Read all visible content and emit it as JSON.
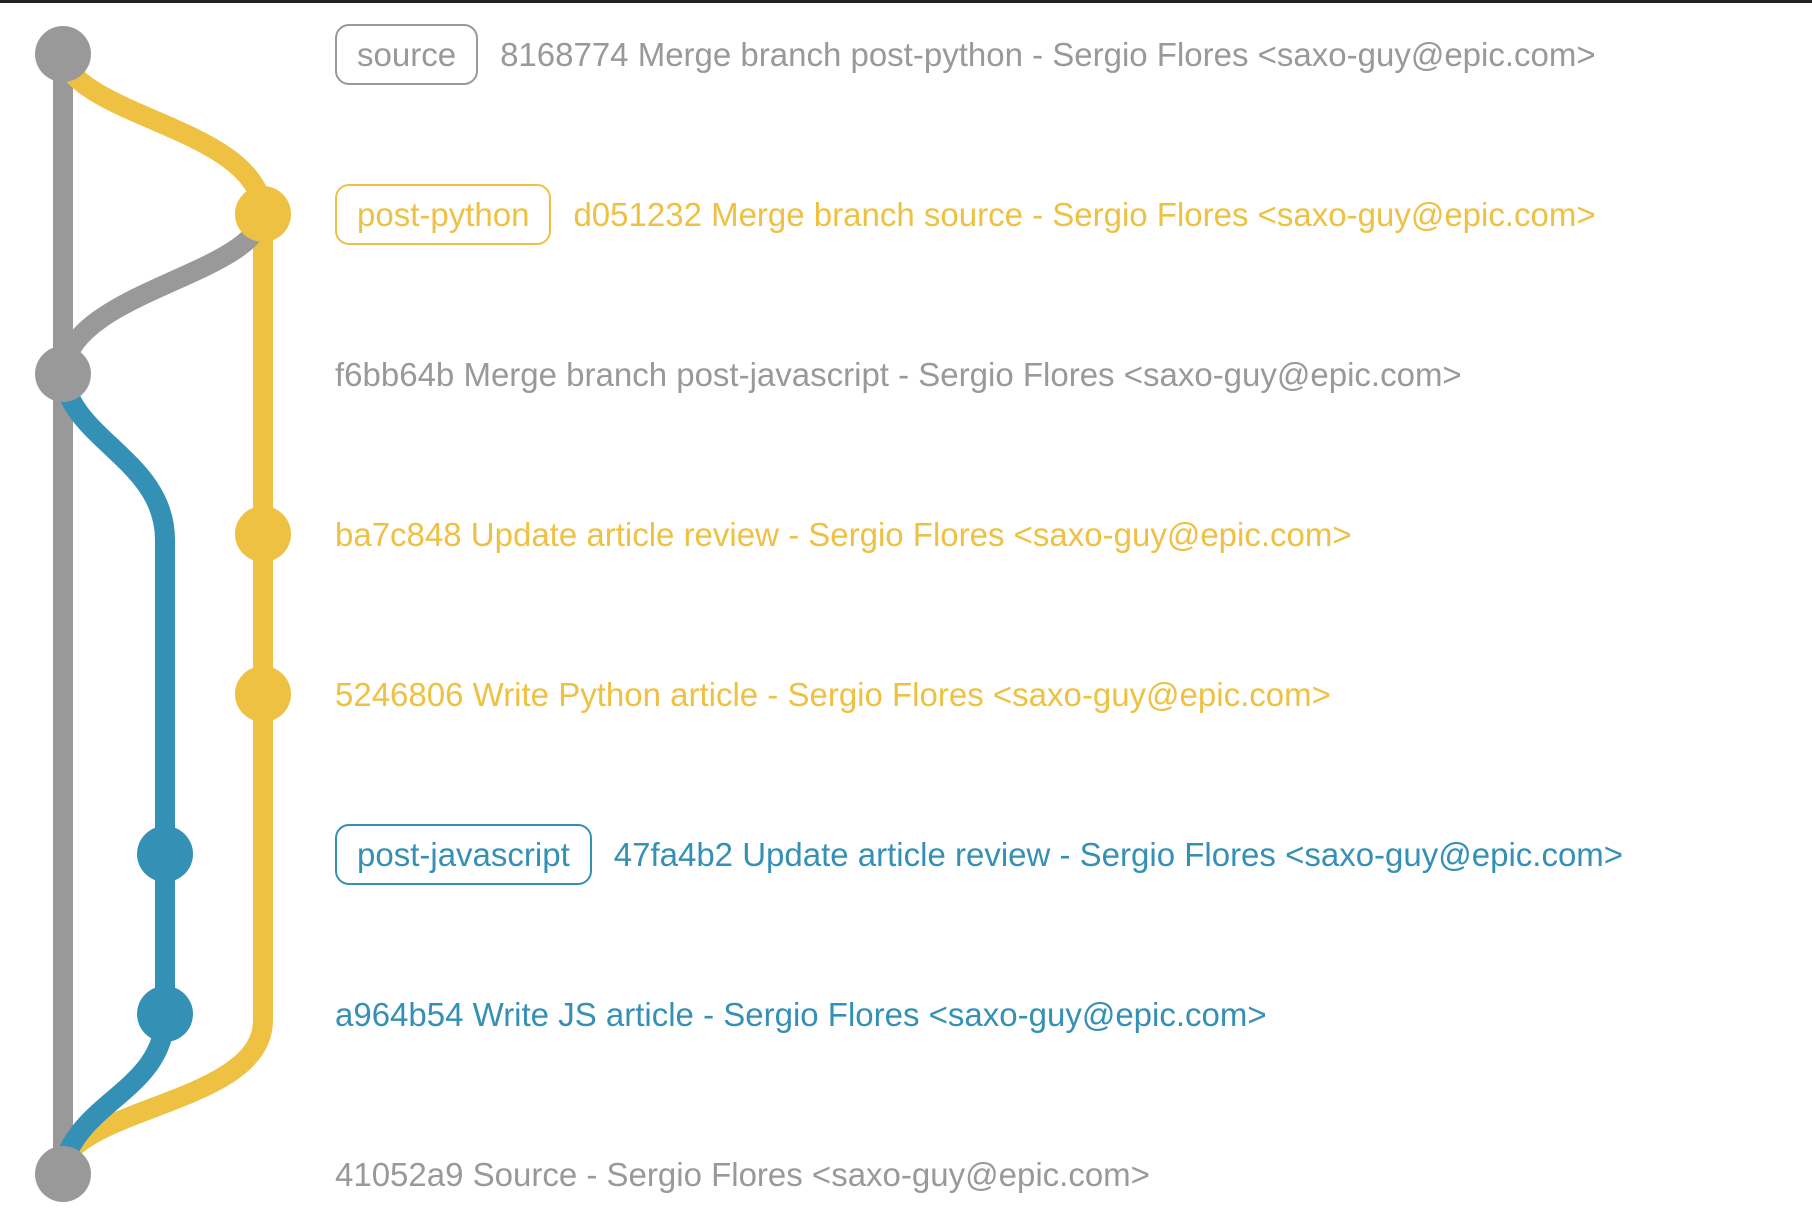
{
  "colors": {
    "source": "#999999",
    "post-python": "#eec143",
    "post-javascript": "#3590b5"
  },
  "commits": [
    {
      "tag": "source",
      "text": "8168774 Merge branch post-python - Sergio Flores <saxo-guy@epic.com>",
      "branch": "source"
    },
    {
      "tag": "post-python",
      "text": "d051232 Merge branch source - Sergio Flores <saxo-guy@epic.com>",
      "branch": "post-python"
    },
    {
      "tag": "",
      "text": "f6bb64b Merge branch post-javascript - Sergio Flores <saxo-guy@epic.com>",
      "branch": "source"
    },
    {
      "tag": "",
      "text": "ba7c848 Update article review - Sergio Flores <saxo-guy@epic.com>",
      "branch": "post-python"
    },
    {
      "tag": "",
      "text": "5246806 Write Python article - Sergio Flores <saxo-guy@epic.com>",
      "branch": "post-python"
    },
    {
      "tag": "post-javascript",
      "text": "47fa4b2 Update article review - Sergio Flores <saxo-guy@epic.com>",
      "branch": "post-javascript"
    },
    {
      "tag": "",
      "text": "a964b54 Write JS article - Sergio Flores <saxo-guy@epic.com>",
      "branch": "post-javascript"
    },
    {
      "tag": "",
      "text": "41052a9 Source - Sergio Flores <saxo-guy@epic.com>",
      "branch": "source"
    }
  ]
}
